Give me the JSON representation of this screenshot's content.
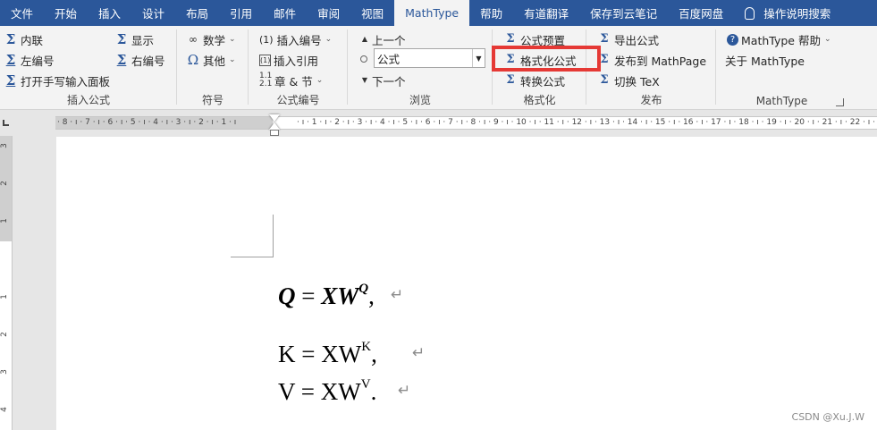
{
  "tabs": [
    "文件",
    "开始",
    "插入",
    "设计",
    "布局",
    "引用",
    "邮件",
    "审阅",
    "视图",
    "MathType",
    "帮助",
    "有道翻译",
    "保存到云笔记",
    "百度网盘",
    "操作说明搜索"
  ],
  "ribbon": {
    "insert_formula": {
      "label": "插入公式",
      "inline": "内联",
      "display": "显示",
      "left_number": "左编号",
      "right_number": "右编号",
      "handwriting": "打开手写输入面板"
    },
    "symbols": {
      "label": "符号",
      "math": "数学",
      "other": "其他"
    },
    "numbering": {
      "label": "公式编号",
      "insert_number": "插入编号",
      "insert_number_prefix": "(1)",
      "insert_reference": "插入引用",
      "chapter_section": "章 & 节"
    },
    "browse": {
      "label": "浏览",
      "previous": "上一个",
      "next": "下一个",
      "combo_value": "公式"
    },
    "format": {
      "label": "格式化",
      "preset": "公式预置",
      "format_equations": "格式化公式",
      "convert": "转换公式"
    },
    "publish": {
      "label": "发布",
      "export": "导出公式",
      "publish_mathpage": "发布到 MathPage",
      "toggle_tex": "切换 TeX"
    },
    "mathtype": {
      "label": "MathType",
      "help": "MathType 帮助",
      "about": "关于 MathType"
    }
  },
  "colors": {
    "tab_bar": "#2b579a",
    "highlight": "#e53935"
  },
  "document": {
    "eq1": {
      "lhs": "Q",
      "eq": "=",
      "rhs": "XW",
      "sup": "Q",
      "punct": ","
    },
    "eq2": {
      "lhs": "K",
      "eq": "=",
      "rhs": "XW",
      "sup": "K",
      "punct": ","
    },
    "eq3": {
      "lhs": "V",
      "eq": "=",
      "rhs": "XW",
      "sup": "V",
      "punct": "."
    },
    "pilcrow": "↵"
  },
  "watermark": "CSDN @Xu.J.W"
}
